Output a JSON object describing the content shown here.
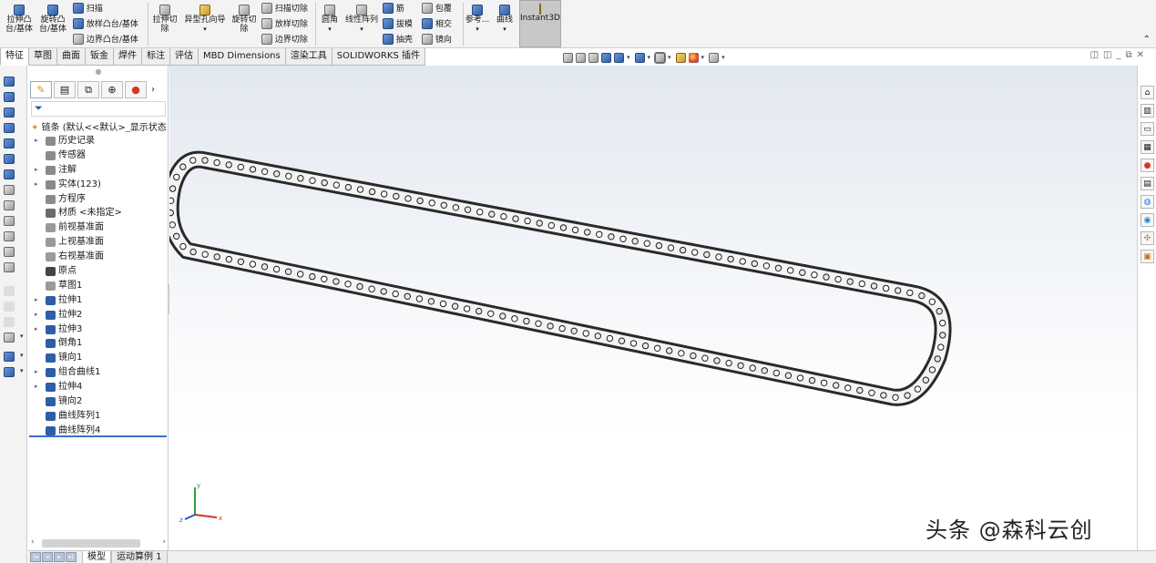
{
  "ribbon": {
    "extrude_boss": "拉伸凸\n台/基体",
    "revolve_boss": "旋转凸\n台/基体",
    "sweep": "扫描",
    "loft_boss": "放样凸台/基体",
    "boundary_boss": "边界凸台/基体",
    "extrude_cut": "拉伸切\n除",
    "hole_wizard": "异型孔向导",
    "revolve_cut": "旋转切\n除",
    "swept_cut": "扫描切除",
    "lofted_cut": "放样切除",
    "boundary_cut": "边界切除",
    "fillet": "圆角",
    "linear_pattern": "线性阵列",
    "rib": "筋",
    "draft": "拔模",
    "shell": "抽壳",
    "wrap": "包覆",
    "intersect": "相交",
    "mirror": "镜向",
    "reference": "参考...",
    "curves": "曲线",
    "instant3d": "Instant3D"
  },
  "tabs": [
    "特征",
    "草图",
    "曲面",
    "钣金",
    "焊件",
    "标注",
    "评估",
    "MBD Dimensions",
    "渲染工具",
    "SOLIDWORKS 插件"
  ],
  "active_tab_index": 0,
  "feature_manager": {
    "root_label": "链条 (默认<<默认>_显示状态",
    "items": [
      {
        "label": "历史记录",
        "expandable": true,
        "icon": "history-icon",
        "color": "#8a8a8a"
      },
      {
        "label": "传感器",
        "expandable": false,
        "icon": "sensor-icon",
        "color": "#8a8a8a"
      },
      {
        "label": "注解",
        "expandable": true,
        "icon": "annotation-icon",
        "color": "#8a8a8a"
      },
      {
        "label": "实体(123)",
        "expandable": true,
        "icon": "solid-bodies-icon",
        "color": "#8a8a8a"
      },
      {
        "label": "方程序",
        "expandable": false,
        "icon": "equations-icon",
        "color": "#8a8a8a"
      },
      {
        "label": "材质 <未指定>",
        "expandable": false,
        "icon": "material-icon",
        "color": "#6b6b6b"
      },
      {
        "label": "前视基准面",
        "expandable": false,
        "icon": "plane-icon",
        "color": "#9a9a9a"
      },
      {
        "label": "上视基准面",
        "expandable": false,
        "icon": "plane-icon",
        "color": "#9a9a9a"
      },
      {
        "label": "右视基准面",
        "expandable": false,
        "icon": "plane-icon",
        "color": "#9a9a9a"
      },
      {
        "label": "原点",
        "expandable": false,
        "icon": "origin-icon",
        "color": "#444444"
      },
      {
        "label": "草图1",
        "expandable": false,
        "icon": "sketch-icon",
        "color": "#9a9a9a"
      },
      {
        "label": "拉伸1",
        "expandable": true,
        "icon": "extrude-icon",
        "color": "#2e5ea8"
      },
      {
        "label": "拉伸2",
        "expandable": true,
        "icon": "extrude-icon",
        "color": "#2e5ea8"
      },
      {
        "label": "拉伸3",
        "expandable": true,
        "icon": "extrude-icon",
        "color": "#2e5ea8"
      },
      {
        "label": "倒角1",
        "expandable": false,
        "icon": "chamfer-icon",
        "color": "#2e5ea8"
      },
      {
        "label": "镜向1",
        "expandable": false,
        "icon": "mirror-icon",
        "color": "#2e5ea8"
      },
      {
        "label": "组合曲线1",
        "expandable": true,
        "icon": "composite-curve-icon",
        "color": "#2e5ea8"
      },
      {
        "label": "拉伸4",
        "expandable": true,
        "icon": "extrude-icon",
        "color": "#2e5ea8"
      },
      {
        "label": "镜向2",
        "expandable": false,
        "icon": "mirror-icon",
        "color": "#2e5ea8"
      },
      {
        "label": "曲线阵列1",
        "expandable": false,
        "icon": "curve-pattern-icon",
        "color": "#2e5ea8"
      },
      {
        "label": "曲线阵列4",
        "expandable": false,
        "icon": "curve-pattern-icon",
        "color": "#2e5ea8"
      }
    ]
  },
  "bottom_tabs": [
    "模型",
    "运动算例 1"
  ],
  "watermark": "头条 @森科云创",
  "triad": {
    "x": "x",
    "y": "y",
    "z": "z"
  },
  "colors": {
    "accent": "#2e5ea8",
    "tree_end_bar": "#3a73c4",
    "axis_x": "#d0312d",
    "axis_y": "#2f9e44",
    "axis_z": "#2c55c9"
  }
}
